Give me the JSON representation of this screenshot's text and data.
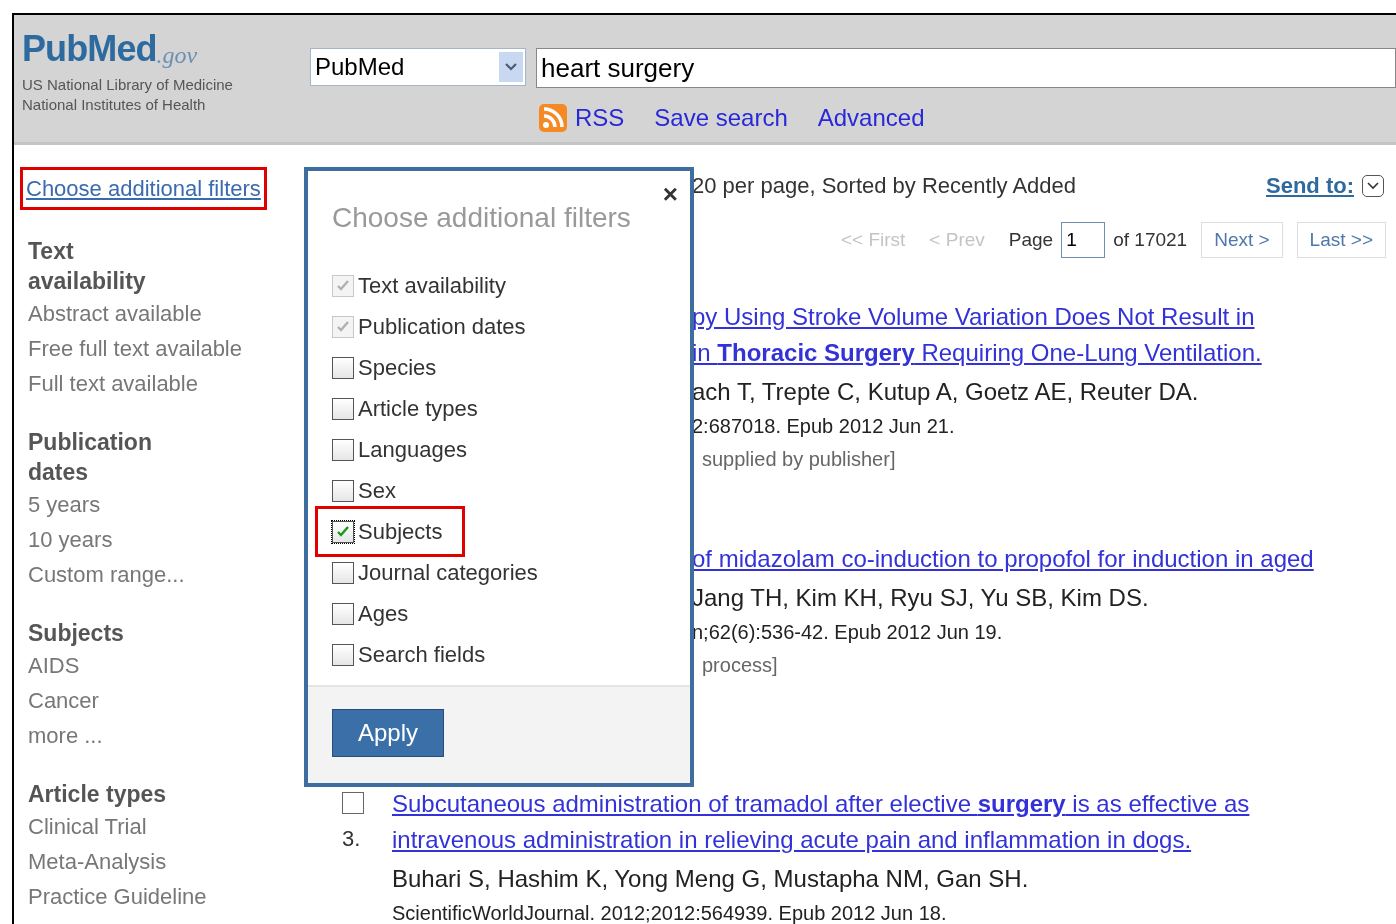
{
  "header": {
    "logo": {
      "name": "PubMed",
      "suffix": ".gov"
    },
    "org_lines": [
      "US National Library of Medicine",
      "National Institutes of Health"
    ],
    "database": "PubMed",
    "query": "heart surgery",
    "links": [
      {
        "kind": "rss",
        "label": "RSS"
      },
      {
        "kind": "plain",
        "label": "Save search"
      },
      {
        "kind": "plain",
        "label": "Advanced"
      }
    ]
  },
  "sidebar": {
    "choose_link": "Choose additional filters",
    "highlighted": true,
    "groups": [
      {
        "title": "Text availability",
        "items": [
          "Abstract available",
          "Free full text available",
          "Full text available"
        ]
      },
      {
        "title": "Publication dates",
        "items": [
          "5 years",
          "10 years",
          "Custom range..."
        ]
      },
      {
        "title": "Subjects",
        "items": [
          "AIDS",
          "Cancer",
          "more ..."
        ]
      },
      {
        "title": "Article types",
        "items": [
          "Clinical Trial",
          "Meta-Analysis",
          "Practice Guideline"
        ]
      }
    ]
  },
  "results_bar": {
    "summary": "20 per page, Sorted by Recently Added",
    "send_to": "Send to:",
    "pager": [
      {
        "kind": "disabled",
        "label": "<< First"
      },
      {
        "kind": "disabled",
        "label": "< Prev"
      },
      {
        "kind": "label",
        "label": "Page"
      },
      {
        "kind": "input",
        "label": "1"
      },
      {
        "kind": "label",
        "label": "of 17021"
      },
      {
        "kind": "button",
        "label": "Next >"
      },
      {
        "kind": "button",
        "label": "Last >>"
      }
    ]
  },
  "results": [
    {
      "title_lines": [
        "py Using Stroke Volume Variation Does Not Result in",
        " in **Thoracic Surgery** Requiring One-Lung Ventilation."
      ],
      "authors": "ach T, Trepte C, Kutup A, Goetz AE, Reuter DA.",
      "journal": "2:687018. Epub 2012 Jun 21.",
      "note": "supplied by publisher]"
    },
    {
      "title_lines": [
        "of midazolam co-induction to propofol for induction in aged"
      ],
      "authors": "Jang TH, Kim KH, Ryu SJ, Yu SB, Kim DS.",
      "journal": "n;62(6):536-42. Epub 2012 Jun 19.",
      "note": "process]"
    },
    {
      "number": "3.",
      "title_lines": [
        "Subcutaneous administration of tramadol after elective **surgery** is as effective as",
        "intravenous administration in relieving acute pain and inflammation in dogs."
      ],
      "authors": "Buhari S, Hashim K, Yong Meng G, Mustapha NM, Gan SH.",
      "journal": "ScientificWorldJournal. 2012;2012:564939. Epub 2012 Jun 18.",
      "checked": false
    }
  ],
  "popup": {
    "close": "×",
    "title": "Choose additional filters",
    "options": [
      {
        "label": "Text availability",
        "checked": true,
        "disabled": true,
        "highlighted": false
      },
      {
        "label": "Publication dates",
        "checked": true,
        "disabled": true,
        "highlighted": false
      },
      {
        "label": "Species",
        "checked": false,
        "disabled": false,
        "highlighted": false
      },
      {
        "label": "Article types",
        "checked": false,
        "disabled": false,
        "highlighted": false
      },
      {
        "label": "Languages",
        "checked": false,
        "disabled": false,
        "highlighted": false
      },
      {
        "label": "Sex",
        "checked": false,
        "disabled": false,
        "highlighted": false
      },
      {
        "label": "Subjects",
        "checked": true,
        "disabled": false,
        "highlighted": true
      },
      {
        "label": "Journal categories",
        "checked": false,
        "disabled": false,
        "highlighted": false
      },
      {
        "label": "Ages",
        "checked": false,
        "disabled": false,
        "highlighted": false
      },
      {
        "label": "Search fields",
        "checked": false,
        "disabled": false,
        "highlighted": false
      }
    ],
    "apply": "Apply"
  }
}
